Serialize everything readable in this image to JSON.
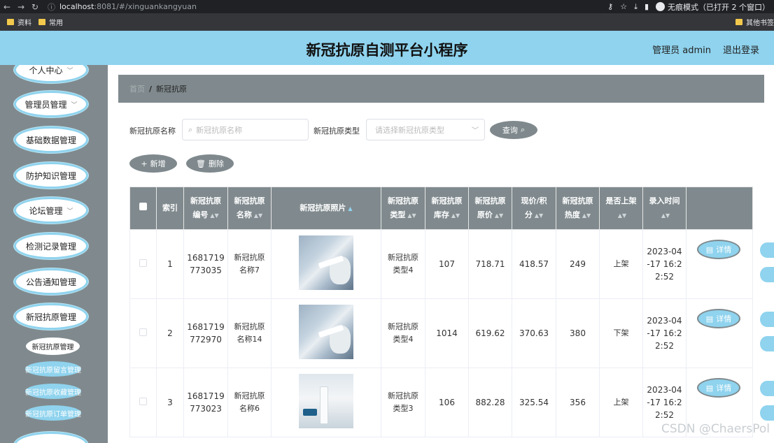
{
  "browser": {
    "url_host": "localhost",
    "url_path": ":8081/#/xinguankangyuan",
    "incognito_label": "无痕模式（已打开 2 个窗口）"
  },
  "bookmarks": {
    "items": [
      "资料",
      "常用"
    ],
    "right": "其他书签"
  },
  "header": {
    "title": "新冠抗原自测平台小程序",
    "user_label": "管理员 admin",
    "logout_label": "退出登录"
  },
  "sidebar": {
    "items": [
      {
        "label": "个人中心",
        "has_chevron": true
      },
      {
        "label": "管理员管理",
        "has_chevron": true
      },
      {
        "label": "基础数据管理",
        "has_chevron": false
      },
      {
        "label": "防护知识管理",
        "has_chevron": false
      },
      {
        "label": "论坛管理",
        "has_chevron": true
      },
      {
        "label": "检测记录管理",
        "has_chevron": false
      },
      {
        "label": "公告通知管理",
        "has_chevron": false
      },
      {
        "label": "新冠抗原管理",
        "has_chevron": false
      }
    ],
    "sub_active": "新冠抗原管理",
    "sub_links": [
      "新冠抗原留言管理",
      "新冠抗原收藏管理",
      "新冠抗原订单管理"
    ]
  },
  "breadcrumb": {
    "home": "首页",
    "separator": "/",
    "current": "新冠抗原"
  },
  "search": {
    "name_label": "新冠抗原名称",
    "name_placeholder": "新冠抗原名称",
    "type_label": "新冠抗原类型",
    "type_placeholder": "请选择新冠抗原类型",
    "query_label": "查询"
  },
  "actions": {
    "add_label": "新增",
    "delete_label": "删除"
  },
  "table": {
    "headers": {
      "index": "索引",
      "code_1": "新冠抗原",
      "code_2": "编号",
      "name_1": "新冠抗原",
      "name_2": "名称",
      "photo": "新冠抗原照片",
      "type_1": "新冠抗原",
      "type_2": "类型",
      "stock_1": "新冠抗原",
      "stock_2": "库存",
      "price_1": "新冠抗原",
      "price_2": "原价",
      "now_1": "现价/积",
      "now_2": "分",
      "heat_1": "新冠抗原",
      "heat_2": "热度",
      "onsale": "是否上架",
      "time": "录入时间"
    },
    "detail_label": "详情",
    "rows": [
      {
        "index": "1",
        "code_1": "1681719",
        "code_2": "773035",
        "name_1": "新冠抗原",
        "name_2": "名称7",
        "type_1": "新冠抗原",
        "type_2": "类型4",
        "stock": "107",
        "price": "718.71",
        "now": "418.57",
        "heat": "249",
        "onsale": "上架",
        "time_1": "2023-04",
        "time_2": "-17 16:2",
        "time_3": "2:52"
      },
      {
        "index": "2",
        "code_1": "1681719",
        "code_2": "772970",
        "name_1": "新冠抗原",
        "name_2": "名称14",
        "type_1": "新冠抗原",
        "type_2": "类型4",
        "stock": "1014",
        "price": "619.62",
        "now": "370.63",
        "heat": "380",
        "onsale": "下架",
        "time_1": "2023-04",
        "time_2": "-17 16:2",
        "time_3": "2:52"
      },
      {
        "index": "3",
        "code_1": "1681719",
        "code_2": "773023",
        "name_1": "新冠抗原",
        "name_2": "名称6",
        "type_1": "新冠抗原",
        "type_2": "类型3",
        "stock": "106",
        "price": "882.28",
        "now": "325.54",
        "heat": "356",
        "onsale": "上架",
        "time_1": "2023-04",
        "time_2": "-17 16:2",
        "time_3": "2:52"
      }
    ]
  },
  "watermark": "CSDN @ChaersPol",
  "colors": {
    "accent": "#8fd3ee",
    "sidebar": "#808a8e"
  }
}
